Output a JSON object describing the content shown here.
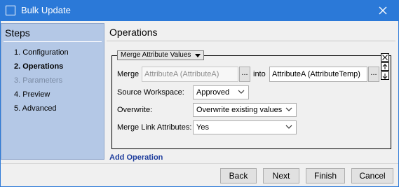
{
  "window": {
    "title": "Bulk Update"
  },
  "steps": {
    "header": "Steps",
    "items": [
      {
        "label": "1. Configuration",
        "state": "normal"
      },
      {
        "label": "2. Operations",
        "state": "active"
      },
      {
        "label": "3. Parameters",
        "state": "disabled"
      },
      {
        "label": "4. Preview",
        "state": "normal"
      },
      {
        "label": "5. Advanced",
        "state": "normal"
      }
    ]
  },
  "main": {
    "header": "Operations",
    "operation": {
      "type_label": "Merge Attribute Values",
      "merge_label": "Merge",
      "source_attribute": "AttributeA (AttributeA)",
      "into_label": "into",
      "target_attribute": "AttributeA (AttributeTemp)",
      "browse_label": "...",
      "source_workspace_label": "Source Workspace:",
      "source_workspace_value": "Approved",
      "overwrite_label": "Overwrite:",
      "overwrite_value": "Overwrite existing values",
      "merge_link_label": "Merge Link Attributes:",
      "merge_link_value": "Yes"
    },
    "add_operation": "Add Operation"
  },
  "buttons": {
    "back": "Back",
    "next": "Next",
    "finish": "Finish",
    "cancel": "Cancel"
  }
}
